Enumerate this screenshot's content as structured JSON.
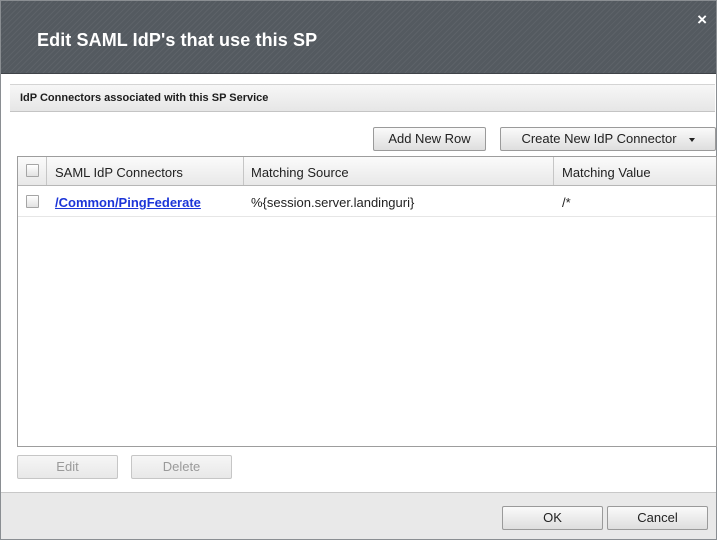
{
  "dialog": {
    "title": "Edit SAML IdP's that use this SP",
    "close_glyph": "×"
  },
  "section": {
    "header": "IdP Connectors associated with this SP Service"
  },
  "toolbar": {
    "add_row_label": "Add New Row",
    "create_connector_label": "Create New IdP Connector"
  },
  "table": {
    "columns": [
      "SAML IdP Connectors",
      "Matching Source",
      "Matching Value"
    ],
    "rows": [
      {
        "connector": "/Common/PingFederate",
        "matching_source": "%{session.server.landinguri}",
        "matching_value": "/*",
        "checked": false
      }
    ]
  },
  "actions": {
    "edit_label": "Edit",
    "delete_label": "Delete"
  },
  "footer": {
    "ok_label": "OK",
    "cancel_label": "Cancel"
  },
  "colors": {
    "titlebar": "#545a60",
    "link": "#1c35d8"
  },
  "icons": {
    "close": "close-icon",
    "dropdown": "chevron-down-icon"
  }
}
